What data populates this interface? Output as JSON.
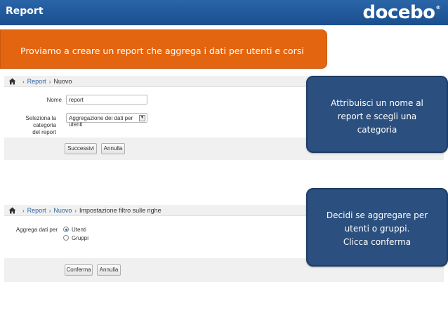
{
  "header": {
    "title": "Report",
    "logo": "docebo",
    "logo_mark": "®"
  },
  "banner": {
    "text": "Proviamo a creare un report che aggrega i dati per utenti e corsi"
  },
  "panel1": {
    "breadcrumb": {
      "home_icon": "home-icon",
      "items": [
        "Report",
        "Nuovo"
      ]
    },
    "name_label": "Nome",
    "name_value": "report",
    "category_label_line1": "Seleziona la categoria",
    "category_label_line2": "del report",
    "category_value": "Aggregazione dei dati per utenti",
    "next_button": "Successivi",
    "cancel_button": "Annulla"
  },
  "panel2": {
    "breadcrumb": {
      "items": [
        "Report",
        "Nuovo",
        "Impostazione filtro sulle righe"
      ]
    },
    "aggregate_label": "Aggrega dati per",
    "options": [
      {
        "label": "Utenti",
        "selected": true
      },
      {
        "label": "Gruppi",
        "selected": false
      }
    ],
    "confirm_button": "Conferma",
    "cancel_button": "Annulla"
  },
  "callout1": {
    "lines": [
      "Attribuisci un nome al",
      "report e scegli una",
      "categoria"
    ]
  },
  "callout2": {
    "lines": [
      "Decidi se aggregare per",
      "utenti o gruppi.",
      "Clicca conferma"
    ]
  },
  "colors": {
    "header_blue": "#1a4f8e",
    "banner_orange": "#e4650f",
    "callout_blue": "#2b4f7e"
  }
}
